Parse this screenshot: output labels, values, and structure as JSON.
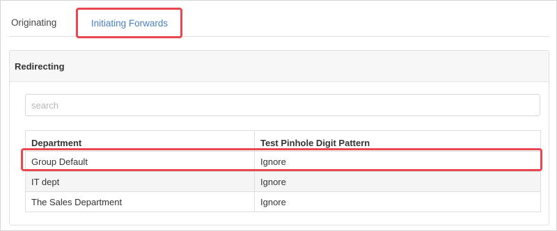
{
  "tabs": [
    {
      "label": "Originating",
      "active": false
    },
    {
      "label": "Initiating Forwards",
      "active": true
    }
  ],
  "panel": {
    "title": "Redirecting"
  },
  "search": {
    "placeholder": "search",
    "value": ""
  },
  "table": {
    "columns": [
      "Department",
      "Test Pinhole Digit Pattern"
    ],
    "rows": [
      {
        "department": "Group Default",
        "pattern": "Ignore",
        "highlighted": true
      },
      {
        "department": "IT dept",
        "pattern": "Ignore",
        "highlighted": false
      },
      {
        "department": "The Sales Department",
        "pattern": "Ignore",
        "highlighted": false
      }
    ]
  },
  "colors": {
    "accent_tab_text": "#4a7fc1",
    "highlight_annotation": "#e8474f",
    "stripe": "#f5f5f5"
  }
}
